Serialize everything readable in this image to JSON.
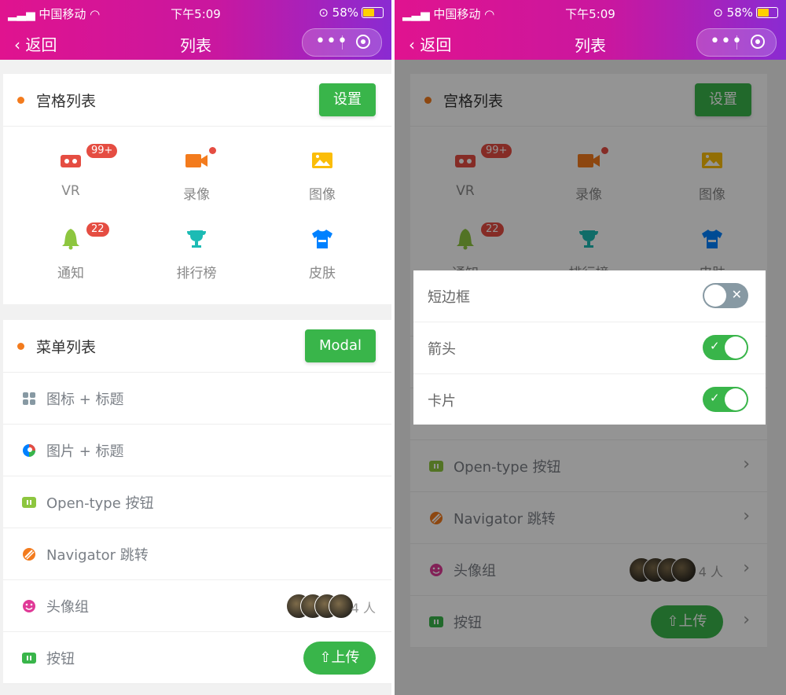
{
  "status": {
    "carrier": "中国移动",
    "time": "下午5:09",
    "battery": "58%"
  },
  "nav": {
    "back": "返回",
    "title": "列表",
    "more": "•••"
  },
  "grid_section": {
    "title": "宫格列表",
    "button": "设置",
    "items": [
      {
        "label": "VR",
        "icon": "vr-icon",
        "color": "#e54d42",
        "badge": "99+"
      },
      {
        "label": "录像",
        "icon": "video-icon",
        "color": "#f37b1d",
        "dot": true
      },
      {
        "label": "图像",
        "icon": "image-icon",
        "color": "#fbbd08"
      },
      {
        "label": "通知",
        "icon": "bell-icon",
        "color": "#8dc63f",
        "badge": "22"
      },
      {
        "label": "排行榜",
        "icon": "trophy-icon",
        "color": "#1cbbb4"
      },
      {
        "label": "皮肤",
        "icon": "shirt-icon",
        "color": "#0081ff"
      }
    ]
  },
  "menu_section": {
    "title": "菜单列表",
    "button": "Modal",
    "items": [
      {
        "label": "图标 + 标题",
        "icon": "grid-icon",
        "color": "#8799a3"
      },
      {
        "label": "图片 + 标题",
        "icon": "image-logo-icon",
        "color": "#0081ff"
      },
      {
        "label": "Open-type 按钮",
        "icon": "open-type-icon",
        "color": "#8dc63f"
      },
      {
        "label": "Navigator 跳转",
        "icon": "navigator-icon",
        "color": "#f37b1d"
      },
      {
        "label": "头像组",
        "icon": "smile-icon",
        "color": "#e03997",
        "count": "4 人"
      },
      {
        "label": "按钮",
        "icon": "button-icon",
        "color": "#39b54a",
        "upload": "⇧上传"
      }
    ]
  },
  "modal": {
    "rows": [
      {
        "label": "短边框",
        "on": false
      },
      {
        "label": "箭头",
        "on": true
      },
      {
        "label": "卡片",
        "on": true
      }
    ]
  },
  "colors": {
    "accent_green": "#39b54a",
    "nav_gradient": [
      "#e0138f",
      "#8a2bd2"
    ],
    "dot_orange": "#f37b1d",
    "badge_red": "#e54d42"
  }
}
